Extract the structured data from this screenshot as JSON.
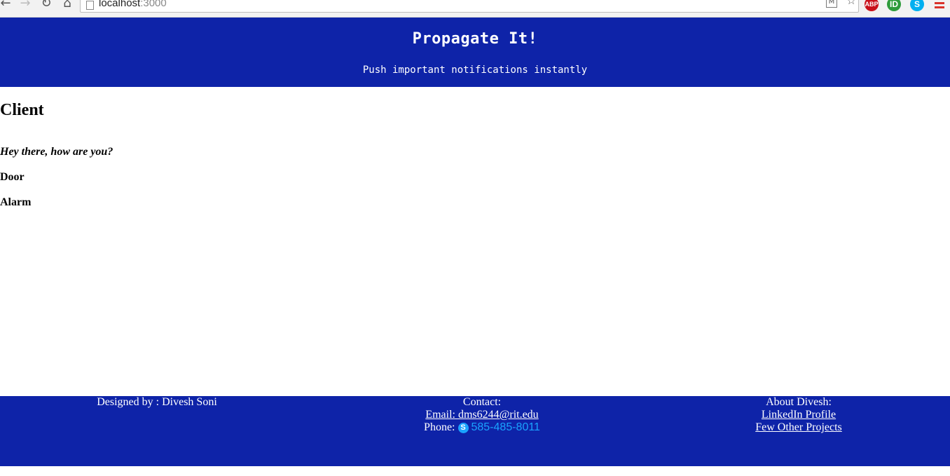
{
  "browser": {
    "url_host": "localhost",
    "url_port": ":3000",
    "extensions": {
      "abp_label": "ABP",
      "ib_label": "ID",
      "skype_label": "S"
    }
  },
  "header": {
    "title": "Propagate It!",
    "subtitle": "Push important notifications instantly"
  },
  "main": {
    "heading": "Client",
    "messages": [
      "Hey there, how are you?",
      "Door",
      "Alarm"
    ]
  },
  "footer": {
    "designed_by": "Designed by : Divesh Soni",
    "contact_heading": "Contact:",
    "email_link": "Email: dms6244@rit.edu",
    "phone_label": "Phone:",
    "skype_glyph": "S",
    "phone_number": "585-485-8011",
    "about_heading": "About Divesh:",
    "linkedin_link": "LinkedIn Profile",
    "projects_link": "Few Other Projects"
  },
  "colors": {
    "brand_blue": "#0e23a8",
    "phone_blue": "#1aa3ff"
  }
}
